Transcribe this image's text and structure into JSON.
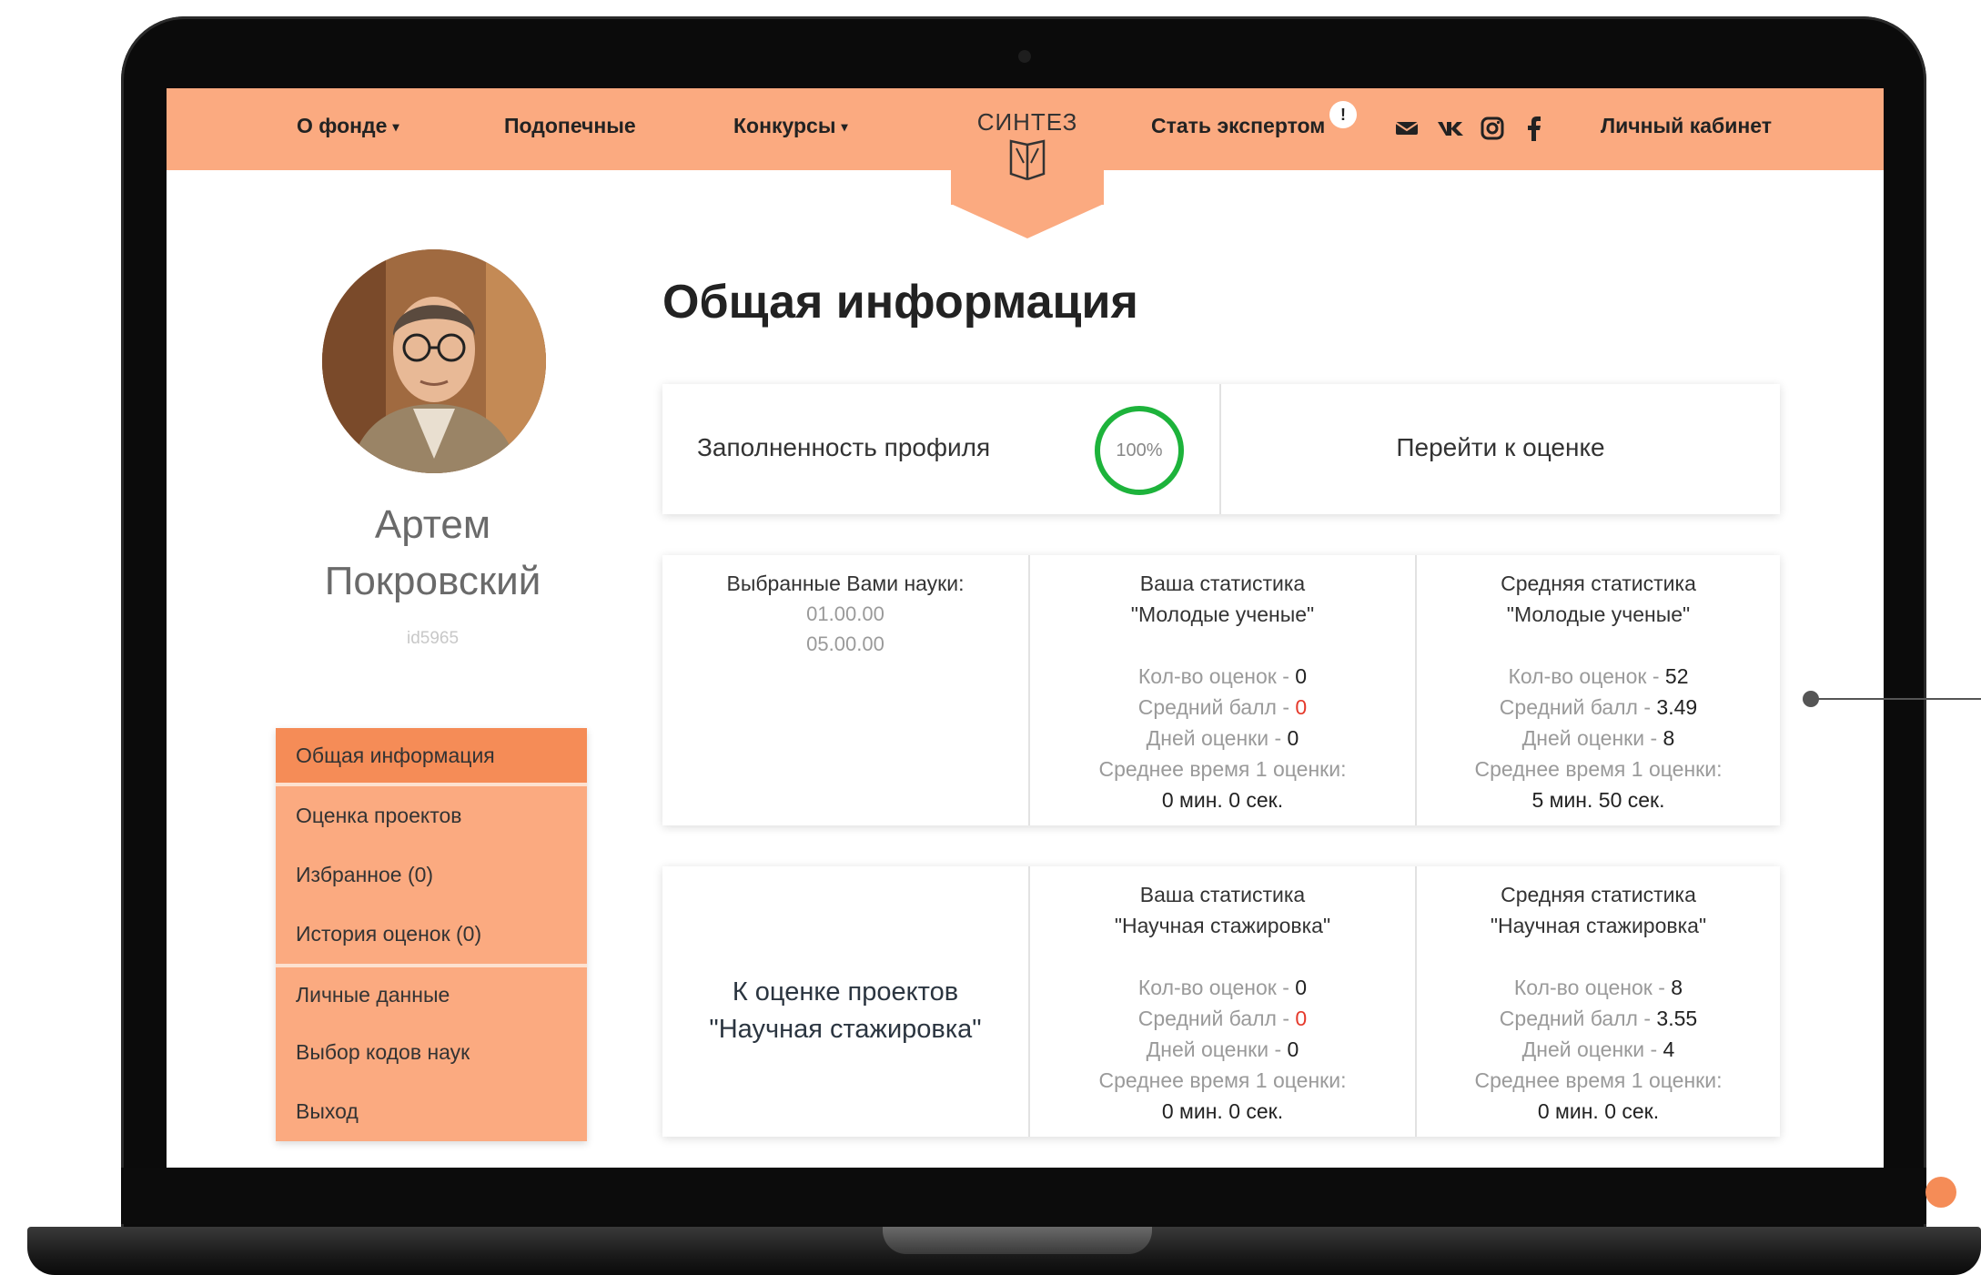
{
  "nav": {
    "about": "О фонде",
    "wards": "Подопечные",
    "contests": "Конкурсы",
    "logo_text": "СИНТЕЗ",
    "become_expert": "Стать экспертом",
    "expert_badge": "!",
    "cabinet": "Личный кабинет",
    "caret": "▾"
  },
  "social": [
    "mail-icon",
    "vk-icon",
    "instagram-icon",
    "facebook-icon"
  ],
  "colors": {
    "brand": "#fbaa80",
    "active": "#f58c57",
    "progress": "#1db33b",
    "alert": "#e53a2c"
  },
  "profile": {
    "first_name": "Артем",
    "last_name": "Покровский",
    "id": "id5965"
  },
  "menu": [
    {
      "label": "Общая информация",
      "active": true
    },
    {
      "label": "Оценка проектов"
    },
    {
      "label": "Избранное (0)"
    },
    {
      "label": "История оценок (0)"
    },
    {
      "label": "Личные данные"
    },
    {
      "label": "Выбор кодов наук"
    },
    {
      "label": "Выход"
    }
  ],
  "main": {
    "title": "Общая информация",
    "profile_fill_label": "Заполненность профиля",
    "profile_fill_value": "100%",
    "profile_fill_fraction": 1.0,
    "go_to_evaluation": "Перейти к оценке"
  },
  "block1": {
    "sciences_label": "Выбранные Вами науки:",
    "sciences": [
      "01.00.00",
      "05.00.00"
    ],
    "your_title_1": "Ваша статистика",
    "your_title_2": "\"Молодые ученые\"",
    "your_count_label": "Кол-во оценок - ",
    "your_count": "0",
    "your_avg_label": "Средний балл - ",
    "your_avg": "0",
    "your_days_label": "Дней оценки - ",
    "your_days": "0",
    "your_time_label": "Среднее время 1 оценки:",
    "your_time": "0 мин. 0 сек.",
    "avg_title_1": "Средняя статистика",
    "avg_title_2": "\"Молодые ученые\"",
    "avg_count_label": "Кол-во оценок - ",
    "avg_count": "52",
    "avg_avg_label": "Средний балл - ",
    "avg_avg": "3.49",
    "avg_days_label": "Дней оценки - ",
    "avg_days": "8",
    "avg_time_label": "Среднее время 1 оценки:",
    "avg_time": "5 мин. 50 сек."
  },
  "block2": {
    "cta_1": "К оценке проектов",
    "cta_2": "\"Научная стажировка\"",
    "your_title_1": "Ваша статистика",
    "your_title_2": "\"Научная стажировка\"",
    "your_count_label": "Кол-во оценок - ",
    "your_count": "0",
    "your_avg_label": "Средний балл - ",
    "your_avg": "0",
    "your_days_label": "Дней оценки - ",
    "your_days": "0",
    "your_time_label": "Среднее время 1 оценки:",
    "your_time": "0 мин. 0 сек.",
    "avg_title_1": "Средняя статистика",
    "avg_title_2": "\"Научная стажировка\"",
    "avg_count_label": "Кол-во оценок - ",
    "avg_count": "8",
    "avg_avg_label": "Средний балл - ",
    "avg_avg": "3.55",
    "avg_days_label": "Дней оценки - ",
    "avg_days": "4",
    "avg_time_label": "Среднее время 1 оценки:",
    "avg_time": "0 мин. 0 сек."
  }
}
